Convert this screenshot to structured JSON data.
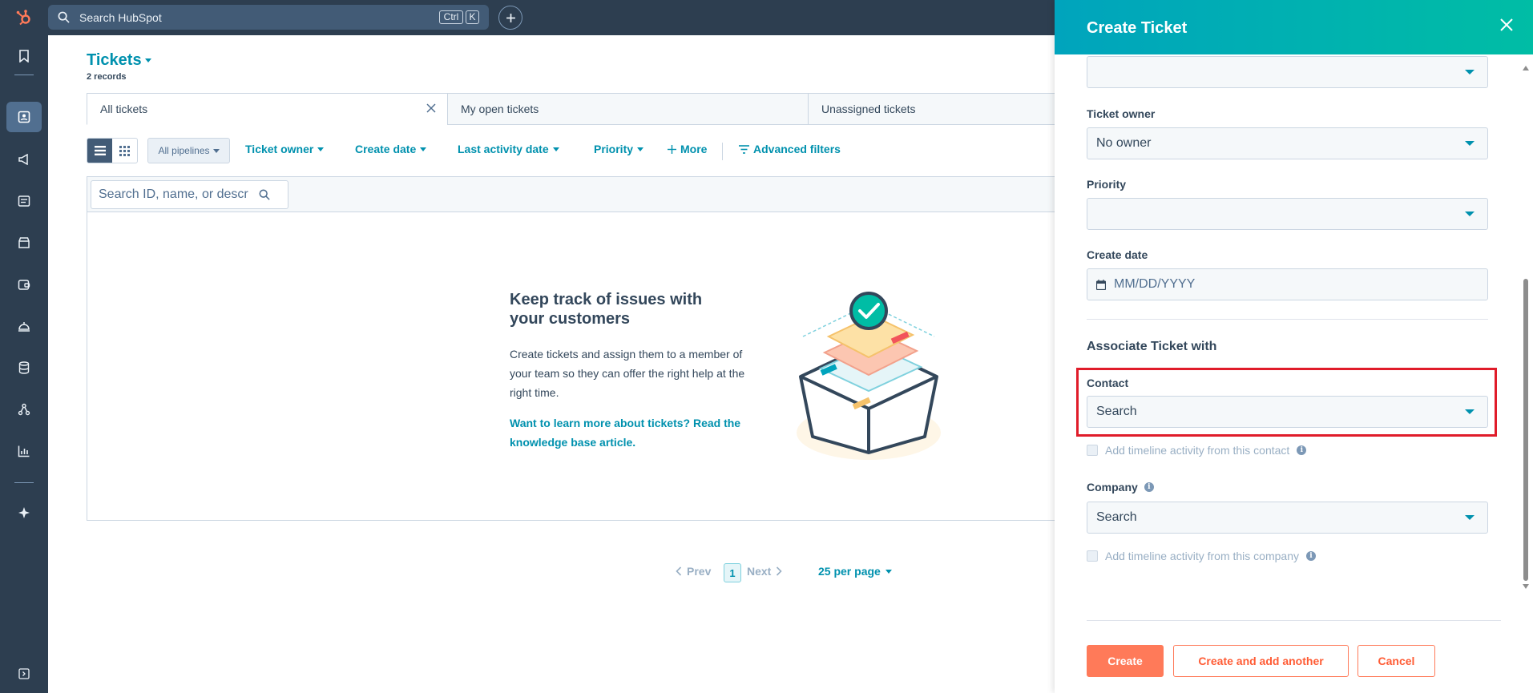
{
  "topbar": {
    "search_placeholder": "Search HubSpot",
    "shortcut_ctrl": "Ctrl",
    "shortcut_key": "K"
  },
  "page": {
    "title": "Tickets",
    "records": "2 records"
  },
  "tabs": [
    {
      "label": "All tickets"
    },
    {
      "label": "My open tickets"
    },
    {
      "label": "Unassigned tickets"
    }
  ],
  "filters": {
    "pipelines": "All pipelines",
    "ticket_owner": "Ticket owner",
    "create_date": "Create date",
    "last_activity_date": "Last activity date",
    "priority": "Priority",
    "more": "More",
    "advanced": "Advanced filters"
  },
  "table": {
    "search_placeholder": "Search ID, name, or descr"
  },
  "empty_state": {
    "heading": "Keep track of issues with your customers",
    "body": "Create tickets and assign them to a member of your team so they can offer the right help at the right time.",
    "link": "Want to learn more about tickets? Read the knowledge base article."
  },
  "pagination": {
    "prev": "Prev",
    "page": "1",
    "next": "Next",
    "per_page": "25 per page"
  },
  "panel": {
    "title": "Create Ticket",
    "top_select_value": "",
    "ticket_owner_label": "Ticket owner",
    "ticket_owner_value": "No owner",
    "priority_label": "Priority",
    "priority_value": "",
    "create_date_label": "Create date",
    "create_date_placeholder": "MM/DD/YYYY",
    "associate_heading": "Associate Ticket with",
    "contact_label": "Contact",
    "contact_value": "Search",
    "contact_timeline": "Add timeline activity from this contact",
    "company_label": "Company",
    "company_value": "Search",
    "company_timeline": "Add timeline activity from this company",
    "create_btn": "Create",
    "create_another_btn": "Create and add another",
    "cancel_btn": "Cancel"
  },
  "colors": {
    "accent": "#0091ae",
    "brand_orange": "#ff7a59",
    "nav_dark": "#2d3e50",
    "highlight_red": "#e01c2a"
  }
}
